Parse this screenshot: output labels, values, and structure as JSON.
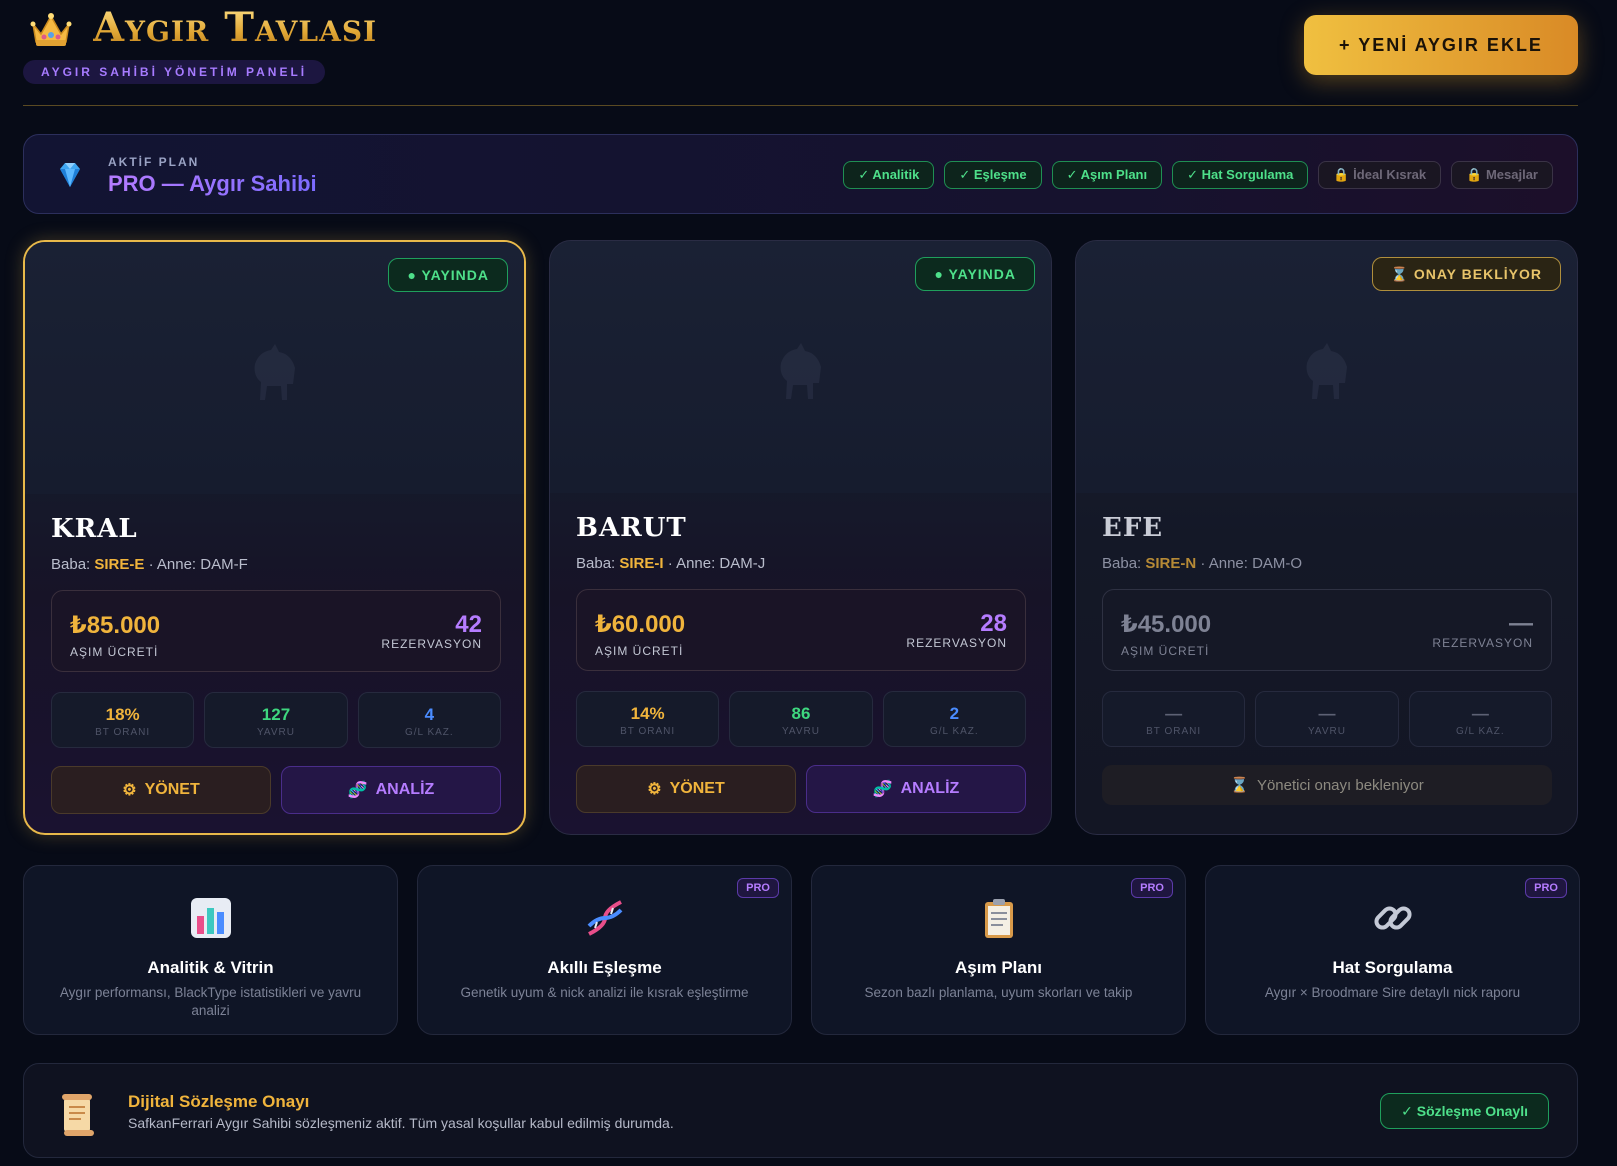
{
  "header": {
    "brand": "Aygır Tavlası",
    "subtitle": "AYGIR SAHİBİ YÖNETİM PANELİ",
    "add_button": "+ YENİ AYGIR EKLE",
    "crown_icon": "crown-icon"
  },
  "plan": {
    "label": "AKTİF PLAN",
    "name": "PRO — Aygır Sahibi",
    "icon": "diamond-icon",
    "features": [
      {
        "label": "✓ Analitik",
        "enabled": true
      },
      {
        "label": "✓ Eşleşme",
        "enabled": true
      },
      {
        "label": "✓ Aşım Planı",
        "enabled": true
      },
      {
        "label": "✓ Hat Sorgulama",
        "enabled": true
      },
      {
        "label": "🔒 İdeal Kısrak",
        "enabled": false
      },
      {
        "label": "🔒 Mesajlar",
        "enabled": false
      }
    ]
  },
  "stallions": [
    {
      "name": "KRAL",
      "status": "● YAYINDA",
      "baba_label": "Baba:",
      "sire": "SIRE-E",
      "dam_text": "· Anne: DAM-F",
      "fee": "₺85.000",
      "fee_label": "AŞIM ÜCRETİ",
      "reservations": "42",
      "reservations_label": "REZERVASYON",
      "stats": [
        {
          "value": "18%",
          "label": "BT ORANI"
        },
        {
          "value": "127",
          "label": "YAVRU"
        },
        {
          "value": "4",
          "label": "G/L KAZ."
        }
      ],
      "manage_label": "YÖNET",
      "analyze_label": "ANALİZ"
    },
    {
      "name": "BARUT",
      "status": "● YAYINDA",
      "baba_label": "Baba:",
      "sire": "SIRE-I",
      "dam_text": "· Anne: DAM-J",
      "fee": "₺60.000",
      "fee_label": "AŞIM ÜCRETİ",
      "reservations": "28",
      "reservations_label": "REZERVASYON",
      "stats": [
        {
          "value": "14%",
          "label": "BT ORANI"
        },
        {
          "value": "86",
          "label": "YAVRU"
        },
        {
          "value": "2",
          "label": "G/L KAZ."
        }
      ],
      "manage_label": "YÖNET",
      "analyze_label": "ANALİZ"
    },
    {
      "name": "EFE",
      "status": "⌛ ONAY BEKLİYOR",
      "baba_label": "Baba:",
      "sire": "SIRE-N",
      "dam_text": "· Anne: DAM-O",
      "fee": "₺45.000",
      "fee_label": "AŞIM ÜCRETİ",
      "reservations": "—",
      "reservations_label": "REZERVASYON",
      "stats": [
        {
          "value": "—",
          "label": "BT ORANI"
        },
        {
          "value": "—",
          "label": "YAVRU"
        },
        {
          "value": "—",
          "label": "G/L KAZ."
        }
      ],
      "waiting_text": "Yönetici onayı bekleniyor"
    }
  ],
  "tiles": [
    {
      "title": "Analitik & Vitrin",
      "desc": "Aygır performansı, BlackType istatistikleri ve yavru analizi",
      "pro": "",
      "icon": "bar-chart-icon"
    },
    {
      "title": "Akıllı Eşleşme",
      "desc": "Genetik uyum & nick analizi ile kısrak eşleştirme",
      "pro": "PRO",
      "icon": "dna-icon"
    },
    {
      "title": "Aşım Planı",
      "desc": "Sezon bazlı planlama, uyum skorları ve takip",
      "pro": "PRO",
      "icon": "clipboard-icon"
    },
    {
      "title": "Hat Sorgulama",
      "desc": "Aygır × Broodmare Sire detaylı nick raporu",
      "pro": "PRO",
      "icon": "link-icon"
    }
  ],
  "contract": {
    "title": "Dijital Sözleşme Onayı",
    "desc": "SafkanFerrari Aygır Sahibi sözleşmeniz aktif. Tüm yasal koşullar kabul edilmiş durumda.",
    "button": "✓ Sözleşme Onaylı",
    "icon": "scroll-icon"
  },
  "colors": {
    "gold": "#f0b43c",
    "purple": "#b57cff",
    "green": "#4ee08a",
    "background": "#070b17"
  }
}
